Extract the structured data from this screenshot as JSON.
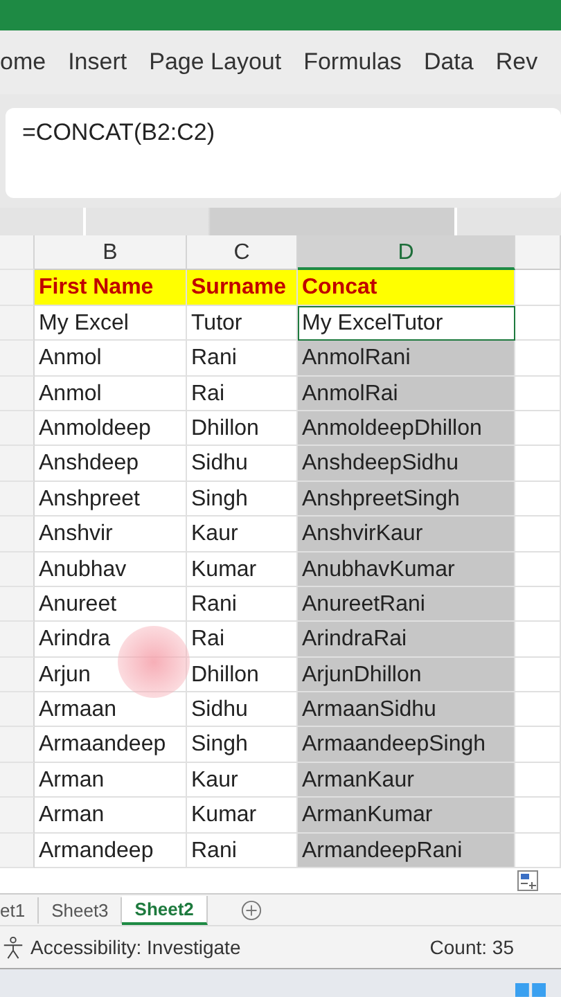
{
  "ribbon": {
    "tabs": [
      {
        "label": "ome",
        "selected": false
      },
      {
        "label": "Insert",
        "selected": false
      },
      {
        "label": "Page Layout",
        "selected": false
      },
      {
        "label": "Formulas",
        "selected": false
      },
      {
        "label": "Data",
        "selected": false
      },
      {
        "label": "Rev",
        "selected": false
      }
    ]
  },
  "formula_bar": {
    "value": "=CONCAT(B2:C2)"
  },
  "grid": {
    "columns": [
      {
        "label": "B",
        "selected": false
      },
      {
        "label": "C",
        "selected": false
      },
      {
        "label": "D",
        "selected": true
      }
    ],
    "header_row": [
      "First Name",
      "Surname",
      "Concat"
    ],
    "rows": [
      {
        "cells": [
          "My Excel",
          "Tutor",
          "My ExcelTutor"
        ],
        "selected": true,
        "active": true
      },
      {
        "cells": [
          "Anmol",
          "Rani",
          "AnmolRani"
        ],
        "selected": true,
        "active": false
      },
      {
        "cells": [
          "Anmol",
          "Rai",
          "AnmolRai"
        ],
        "selected": true,
        "active": false
      },
      {
        "cells": [
          "Anmoldeep",
          "Dhillon",
          "AnmoldeepDhillon"
        ],
        "selected": true,
        "active": false
      },
      {
        "cells": [
          "Anshdeep",
          "Sidhu",
          "AnshdeepSidhu"
        ],
        "selected": true,
        "active": false
      },
      {
        "cells": [
          "Anshpreet",
          "Singh",
          "AnshpreetSingh"
        ],
        "selected": true,
        "active": false
      },
      {
        "cells": [
          "Anshvir",
          "Kaur",
          "AnshvirKaur"
        ],
        "selected": true,
        "active": false
      },
      {
        "cells": [
          "Anubhav",
          "Kumar",
          "AnubhavKumar"
        ],
        "selected": true,
        "active": false
      },
      {
        "cells": [
          "Anureet",
          "Rani",
          "AnureetRani"
        ],
        "selected": true,
        "active": false
      },
      {
        "cells": [
          "Arindra",
          "Rai",
          "ArindraRai"
        ],
        "selected": true,
        "active": false
      },
      {
        "cells": [
          "Arjun",
          "Dhillon",
          "ArjunDhillon"
        ],
        "selected": true,
        "active": false
      },
      {
        "cells": [
          "Armaan",
          "Sidhu",
          "ArmaanSidhu"
        ],
        "selected": true,
        "active": false
      },
      {
        "cells": [
          "Armaandeep",
          "Singh",
          "ArmaandeepSingh"
        ],
        "selected": true,
        "active": false
      },
      {
        "cells": [
          "Arman",
          "Kaur",
          "ArmanKaur"
        ],
        "selected": true,
        "active": false
      },
      {
        "cells": [
          "Arman",
          "Kumar",
          "ArmanKumar"
        ],
        "selected": true,
        "active": false
      },
      {
        "cells": [
          "Armandeep",
          "Rani",
          "ArmandeepRani"
        ],
        "selected": true,
        "active": false
      }
    ]
  },
  "sheet_tabs": [
    {
      "label": "et1",
      "selected": false
    },
    {
      "label": "Sheet3",
      "selected": false
    },
    {
      "label": "Sheet2",
      "selected": true
    }
  ],
  "status_bar": {
    "accessibility": "Accessibility: Investigate",
    "count": "Count: 35"
  }
}
